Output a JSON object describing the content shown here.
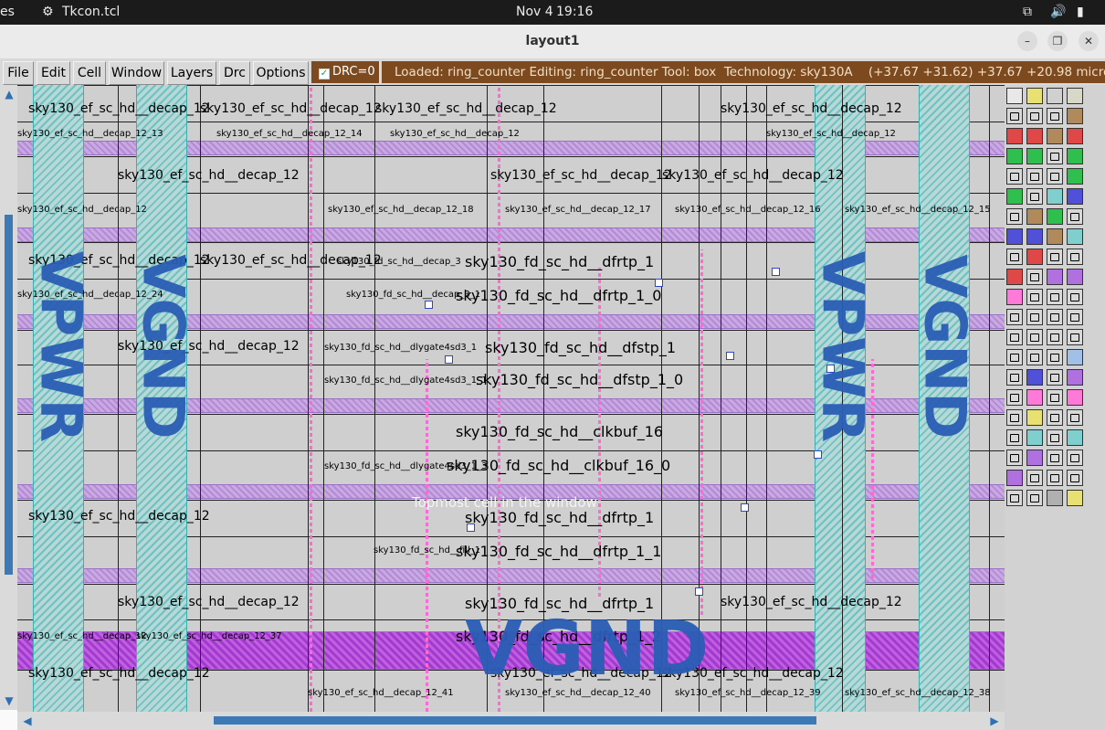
{
  "system_bar": {
    "left_app_fragment": "es",
    "app_name": "Tkcon.tcl",
    "date": "Nov 4",
    "time": "19:16"
  },
  "window": {
    "title": "layout1",
    "controls": {
      "minimize": "–",
      "maximize": "❐",
      "close": "✕"
    }
  },
  "menu": {
    "items": [
      "File",
      "Edit",
      "Cell",
      "Window",
      "Layers",
      "Drc",
      "Options"
    ],
    "drc_label": "DRC=0",
    "status": "Loaded: ring_counter Editing: ring_counter Tool: box  Technology: sky130A    (+37.67 +31.62) +37.67 +20.98 microns"
  },
  "canvas": {
    "overlay_text": "Topmost cell in the window",
    "power_labels": {
      "vpwr": "VPWR",
      "vgnd": "VGND"
    },
    "cells_big": [
      "sky130_fd_sc_hd__dfrtp_1",
      "sky130_fd_sc_hd__dfrtp_1_0",
      "sky130_fd_sc_hd__dfstp_1",
      "sky130_fd_sc_hd__dfstp_1_0",
      "sky130_fd_sc_hd__clkbuf_16",
      "sky130_fd_sc_hd__clkbuf_16_0",
      "sky130_fd_sc_hd__dfrtp_1",
      "sky130_fd_sc_hd__dfrtp_1_1",
      "sky130_fd_sc_hd__dfrtp_1",
      "sky130_fd_sc_hd__dfrtp_1_2"
    ],
    "cells_med": [
      "sky130_ef_sc_hd__decap_12",
      "sky130_ef_sc_hd__decap_12",
      "sky130_ef_sc_hd__decap_12",
      "sky130_ef_sc_hd__decap_12",
      "sky130_ef_sc_hd__decap_12",
      "sky130_ef_sc_hd__decap_12",
      "sky130_ef_sc_hd__decap_12"
    ],
    "cells_small": [
      "sky130_ef_sc_hd__decap_12_13",
      "sky130_ef_sc_hd__decap_12_14",
      "sky130_ef_sc_hd__decap_12",
      "sky130_ef_sc_hd__decap_12_18",
      "sky130_ef_sc_hd__decap_12_17",
      "sky130_ef_sc_hd__decap_12_16",
      "sky130_ef_sc_hd__decap_12_15",
      "sky130_ef_sc_hd__decap_12",
      "sky130_ef_sc_hd__decap_12_24",
      "sky130_fd_sc_hd__decap_3",
      "sky130_fd_sc_hd__decap_3_1",
      "sky130_fd_sc_hd__dlygate4sd3_1",
      "sky130_fd_sc_hd__dlygate4sd3_1_1",
      "sky130_fd_sc_hd__dlygate4sd3_1_3",
      "sky130_fd_sc_hd__fill_1",
      "sky130_ef_sc_hd__decap_12_37",
      "sky130_ef_sc_hd__decap_12_41",
      "sky130_ef_sc_hd__decap_12_40",
      "sky130_ef_sc_hd__decap_12_39",
      "sky130_ef_sc_hd__decap_12_38"
    ]
  },
  "palette": {
    "colors": {
      "lock": "#000000",
      "teal": "#7fcfcf",
      "green": "#2fbf4f",
      "red": "#e04848",
      "pink": "#ff7ad8",
      "tan": "#b08a5a",
      "blue": "#5050d8",
      "purple": "#b070e0",
      "yellow": "#e8e070"
    }
  }
}
